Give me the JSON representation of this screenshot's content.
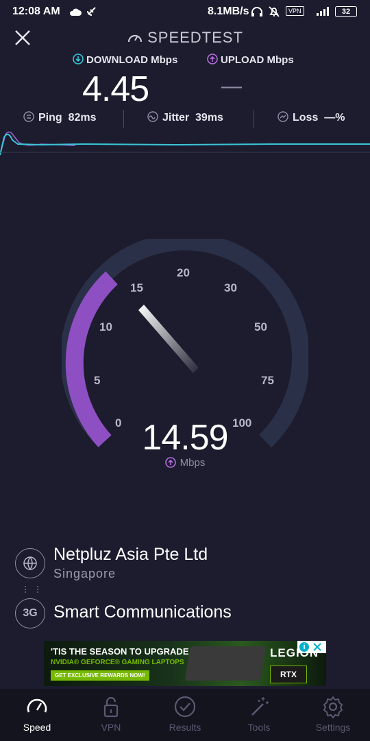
{
  "status_bar": {
    "time": "12:08 AM",
    "net_speed": "8.1MB/s",
    "vpn": "VPN",
    "battery": "32"
  },
  "header": {
    "title": "SPEEDTEST",
    "download_label": "DOWNLOAD Mbps",
    "upload_label": "UPLOAD Mbps",
    "download_value": "4.45",
    "upload_value": "—"
  },
  "stats": {
    "ping_label": "Ping",
    "ping_value": "82ms",
    "jitter_label": "Jitter",
    "jitter_value": "39ms",
    "loss_label": "Loss",
    "loss_value": "—",
    "loss_unit": "%"
  },
  "gauge": {
    "ticks": [
      "0",
      "5",
      "10",
      "15",
      "20",
      "30",
      "50",
      "75",
      "100"
    ],
    "current_value": "14.59",
    "unit": "Mbps",
    "accent": "#8e4fc2"
  },
  "server": {
    "name": "Netpluz Asia Pte Ltd",
    "location": "Singapore"
  },
  "provider": {
    "badge": "3G",
    "name": "Smart Communications"
  },
  "ad": {
    "line1": "'TIS THE SEASON TO UPGRADE",
    "line2": "NVIDIA® GEFORCE® GAMING LAPTOPS",
    "cta": "GET EXCLUSIVE REWARDS NOW!",
    "brand": "LEGION",
    "badge": "RTX"
  },
  "nav": {
    "items": [
      {
        "label": "Speed",
        "icon": "speedometer-icon"
      },
      {
        "label": "VPN",
        "icon": "lock-icon"
      },
      {
        "label": "Results",
        "icon": "check-circle-icon"
      },
      {
        "label": "Tools",
        "icon": "magic-wand-icon"
      },
      {
        "label": "Settings",
        "icon": "gear-icon"
      }
    ],
    "active": "Speed"
  }
}
